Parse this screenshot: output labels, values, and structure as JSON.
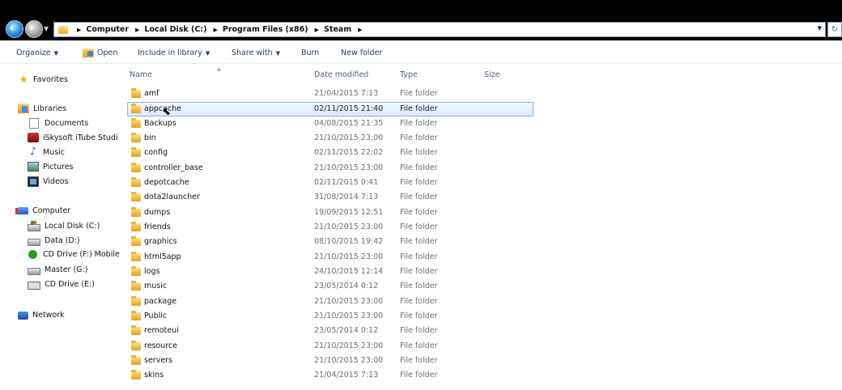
{
  "address": {
    "crumbs": [
      "Computer",
      "Local Disk (C:)",
      "Program Files (x86)",
      "Steam"
    ]
  },
  "toolbar": {
    "organize": "Organize",
    "open": "Open",
    "include_in_library": "Include in library",
    "share_with": "Share with",
    "burn": "Burn",
    "new_folder": "New folder"
  },
  "nav": {
    "favorites": "Favorites",
    "libraries": "Libraries",
    "documents": "Documents",
    "itube": "iSkysoft iTube Studio",
    "music": "Music",
    "pictures": "Pictures",
    "videos": "Videos",
    "computer": "Computer",
    "local_disk": "Local Disk (C:)",
    "data": "Data (D:)",
    "cd_f": "CD Drive (F:) Mobile",
    "master": "Master (G:)",
    "cd_e": "CD Drive (E:)",
    "network": "Network"
  },
  "columns": {
    "name": "Name",
    "date": "Date modified",
    "type": "Type",
    "size": "Size"
  },
  "files": [
    {
      "name": "amf",
      "date": "21/04/2015 7:13",
      "type": "File folder"
    },
    {
      "name": "appcache",
      "date": "02/11/2015 21:40",
      "type": "File folder"
    },
    {
      "name": "Backups",
      "date": "04/08/2015 21:35",
      "type": "File folder"
    },
    {
      "name": "bin",
      "date": "21/10/2015 23:00",
      "type": "File folder"
    },
    {
      "name": "config",
      "date": "02/11/2015 22:02",
      "type": "File folder"
    },
    {
      "name": "controller_base",
      "date": "21/10/2015 23:00",
      "type": "File folder"
    },
    {
      "name": "depotcache",
      "date": "02/11/2015 0:41",
      "type": "File folder"
    },
    {
      "name": "dota2launcher",
      "date": "31/08/2014 7:13",
      "type": "File folder"
    },
    {
      "name": "dumps",
      "date": "19/09/2015 12:51",
      "type": "File folder"
    },
    {
      "name": "friends",
      "date": "21/10/2015 23:00",
      "type": "File folder"
    },
    {
      "name": "graphics",
      "date": "08/10/2015 19:42",
      "type": "File folder"
    },
    {
      "name": "html5app",
      "date": "21/10/2015 23:00",
      "type": "File folder"
    },
    {
      "name": "logs",
      "date": "24/10/2015 12:14",
      "type": "File folder"
    },
    {
      "name": "music",
      "date": "23/05/2014 0:12",
      "type": "File folder"
    },
    {
      "name": "package",
      "date": "21/10/2015 23:00",
      "type": "File folder"
    },
    {
      "name": "Public",
      "date": "21/10/2015 23:00",
      "type": "File folder"
    },
    {
      "name": "remoteui",
      "date": "23/05/2014 0:12",
      "type": "File folder"
    },
    {
      "name": "resource",
      "date": "21/10/2015 23:00",
      "type": "File folder"
    },
    {
      "name": "servers",
      "date": "21/10/2015 23:00",
      "type": "File folder"
    },
    {
      "name": "skins",
      "date": "21/04/2015 7:13",
      "type": "File folder"
    }
  ]
}
